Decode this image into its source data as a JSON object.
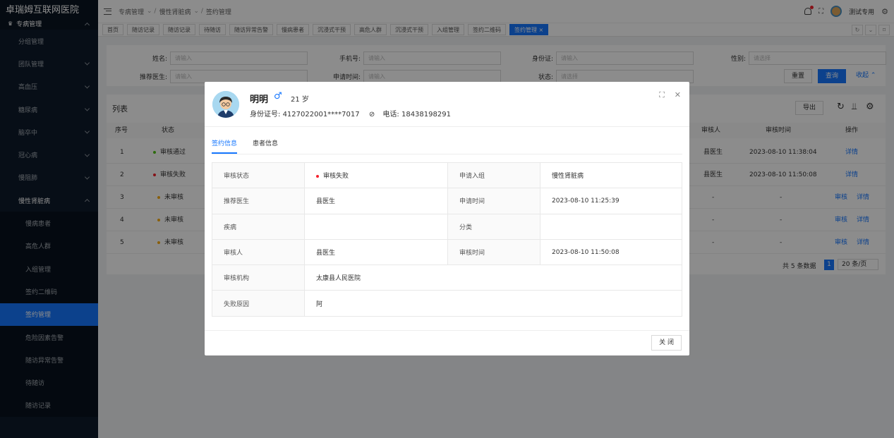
{
  "app": {
    "title": "卓瑞姆互联网医院"
  },
  "sidebar": {
    "group": "专病管理",
    "items": [
      "分组管理",
      "团队管理",
      "高血压",
      "糖尿病",
      "脑卒中",
      "冠心病",
      "慢阻肺",
      "慢性肾脏病"
    ],
    "sub_items": [
      "慢病患者",
      "高危人群",
      "入组管理",
      "签约二维码",
      "签约管理",
      "危险因素告警",
      "随访异常告警",
      "待随访",
      "随访记录"
    ]
  },
  "header": {
    "breadcrumb": [
      "专病管理",
      "慢性肾脏病",
      "签约管理"
    ],
    "user": "测试专用"
  },
  "tabs": [
    "首页",
    "随访记录",
    "随访记录",
    "待随访",
    "随访异常告警",
    "慢病患者",
    "沉浸式干预",
    "高危人群",
    "沉浸式干预",
    "入组管理",
    "签约二维码",
    "签约管理"
  ],
  "filter": {
    "name_label": "姓名:",
    "name_ph": "请输入",
    "phone_label": "手机号:",
    "phone_ph": "请输入",
    "id_label": "身份证:",
    "id_ph": "请输入",
    "gender_label": "性别:",
    "gender_ph": "请选择",
    "doctor_label": "推荐医生:",
    "doctor_ph": "请输入",
    "time_label": "申请时间:",
    "time_ph": "请输入",
    "status_label": "状态:",
    "status_ph": "请选择",
    "reset": "重置",
    "query": "查询",
    "collapse": "收起"
  },
  "list": {
    "title": "列表",
    "export": "导出",
    "headers": {
      "no": "序号",
      "status": "状态",
      "reviewer": "审核人",
      "review_time": "审核时间",
      "action": "操作"
    },
    "rows": [
      {
        "no": "1",
        "status": "审核通过",
        "status_color": "#52c41a",
        "reviewer": "县医生",
        "time": "2023-08-10 11:38:04",
        "audit": "",
        "detail": "详情"
      },
      {
        "no": "2",
        "status": "审核失败",
        "status_color": "#f5222d",
        "reviewer": "县医生",
        "time": "2023-08-10 11:50:08",
        "audit": "",
        "detail": "详情"
      },
      {
        "no": "3",
        "status": "未审核",
        "status_color": "#faad14",
        "reviewer": "-",
        "time": "-",
        "audit": "审核",
        "detail": "详情"
      },
      {
        "no": "4",
        "status": "未审核",
        "status_color": "#faad14",
        "reviewer": "-",
        "time": "-",
        "audit": "审核",
        "detail": "详情"
      },
      {
        "no": "5",
        "status": "未审核",
        "status_color": "#faad14",
        "reviewer": "-",
        "time": "-",
        "audit": "审核",
        "detail": "详情"
      }
    ],
    "total": "共 5 条数据",
    "page": "1",
    "page_size": "20 条/页"
  },
  "modal": {
    "name": "明明",
    "gender_symbol": "♂",
    "age": "21 岁",
    "id_label": "身份证号:",
    "id_value": "4127022001****7017",
    "phone_label": "电话:",
    "phone_value": "18438198291",
    "tabs": [
      "签约信息",
      "患者信息"
    ],
    "fields": {
      "status_k": "审核状态",
      "status_v": "审核失败",
      "group_k": "申请入组",
      "group_v": "慢性肾脏病",
      "doctor_k": "推荐医生",
      "doctor_v": "县医生",
      "apply_time_k": "申请时间",
      "apply_time_v": "2023-08-10 11:25:39",
      "disease_k": "疾病",
      "disease_v": "",
      "category_k": "分类",
      "category_v": "",
      "reviewer_k": "审核人",
      "reviewer_v": "县医生",
      "review_time_k": "审核时间",
      "review_time_v": "2023-08-10 11:50:08",
      "org_k": "审核机构",
      "org_v": "太康县人民医院",
      "reason_k": "失败原因",
      "reason_v": "阿"
    },
    "close": "关 闭"
  },
  "colors": {
    "primary": "#1677ff",
    "sidebar": "#0e1a2b",
    "danger": "#f5222d",
    "success": "#52c41a",
    "warning": "#faad14"
  }
}
